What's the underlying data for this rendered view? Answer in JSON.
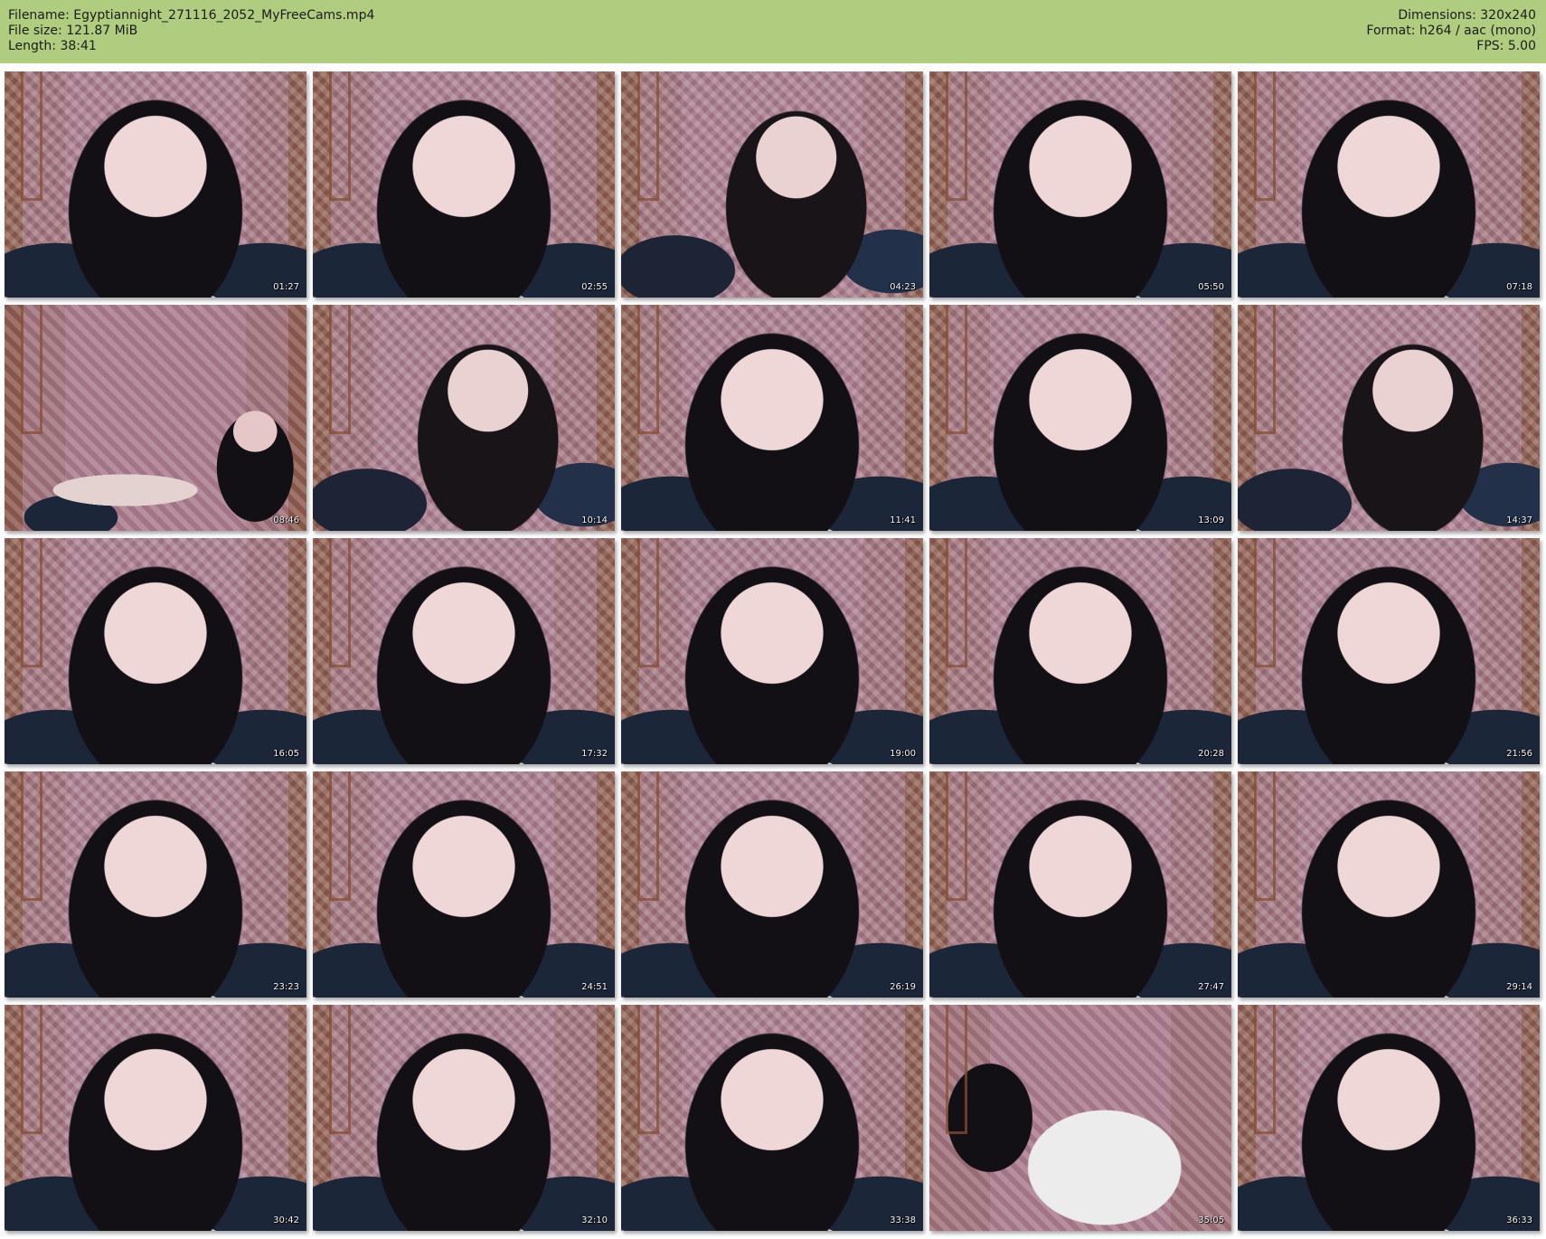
{
  "header": {
    "filename": "Filename: Egyptiannight_271116_2052_MyFreeCams.mp4",
    "file_size": "File size: 121.87 MiB",
    "length": "Length: 38:41",
    "dimensions": "Dimensions: 320x240",
    "format": "Format: h264 / aac (mono)",
    "fps": "FPS: 5.00"
  },
  "thumbnails": [
    {
      "time": "01:27",
      "kind": "close"
    },
    {
      "time": "02:55",
      "kind": "close"
    },
    {
      "time": "04:23",
      "kind": "standard"
    },
    {
      "time": "05:50",
      "kind": "close"
    },
    {
      "time": "07:18",
      "kind": "close"
    },
    {
      "time": "08:46",
      "kind": "wide"
    },
    {
      "time": "10:14",
      "kind": "standard"
    },
    {
      "time": "11:41",
      "kind": "close"
    },
    {
      "time": "13:09",
      "kind": "close"
    },
    {
      "time": "14:37",
      "kind": "standard"
    },
    {
      "time": "16:05",
      "kind": "close"
    },
    {
      "time": "17:32",
      "kind": "close"
    },
    {
      "time": "19:00",
      "kind": "close"
    },
    {
      "time": "20:28",
      "kind": "close"
    },
    {
      "time": "21:56",
      "kind": "close"
    },
    {
      "time": "23:23",
      "kind": "close"
    },
    {
      "time": "24:51",
      "kind": "close"
    },
    {
      "time": "26:19",
      "kind": "close"
    },
    {
      "time": "27:47",
      "kind": "close"
    },
    {
      "time": "29:14",
      "kind": "close"
    },
    {
      "time": "30:42",
      "kind": "close"
    },
    {
      "time": "32:10",
      "kind": "close"
    },
    {
      "time": "33:38",
      "kind": "close"
    },
    {
      "time": "35:05",
      "kind": "blur"
    },
    {
      "time": "36:33",
      "kind": "close"
    }
  ]
}
